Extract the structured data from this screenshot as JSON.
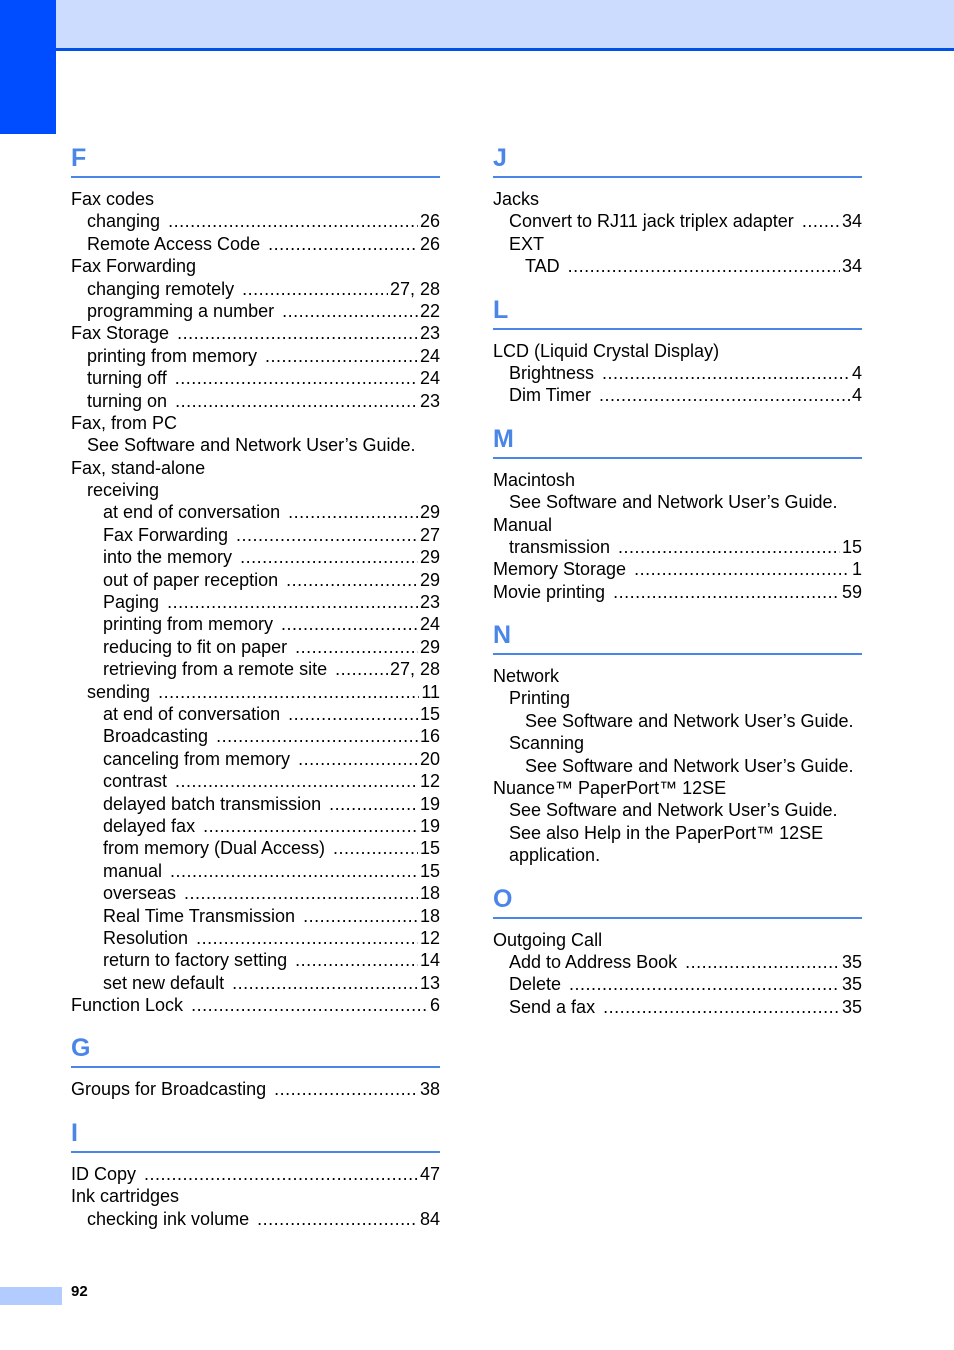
{
  "page_number": "92",
  "colors": {
    "accent": "#4a86e8",
    "tab": "#004dff",
    "header_band": "#ccdcff"
  },
  "left_column": [
    {
      "letter": "F",
      "entries": [
        {
          "level": 0,
          "term": "Fax codes",
          "page": ""
        },
        {
          "level": 1,
          "term": "changing",
          "page": "26"
        },
        {
          "level": 1,
          "term": "Remote Access Code",
          "page": "26"
        },
        {
          "level": 0,
          "term": "Fax Forwarding",
          "page": ""
        },
        {
          "level": 1,
          "term": "changing remotely",
          "page": "27, 28"
        },
        {
          "level": 1,
          "term": "programming a number",
          "page": "22"
        },
        {
          "level": 0,
          "term": "Fax Storage",
          "page": "23"
        },
        {
          "level": 1,
          "term": "printing from memory",
          "page": "24"
        },
        {
          "level": 1,
          "term": "turning off",
          "page": "24"
        },
        {
          "level": 1,
          "term": "turning on",
          "page": "23"
        },
        {
          "level": 0,
          "term": "Fax, from PC",
          "page": ""
        },
        {
          "level": 1,
          "term": "See Software and Network User’s Guide.",
          "page": ""
        },
        {
          "level": 0,
          "term": "Fax, stand-alone",
          "page": ""
        },
        {
          "level": 1,
          "term": "receiving",
          "page": ""
        },
        {
          "level": 2,
          "term": "at end of conversation",
          "page": "29"
        },
        {
          "level": 2,
          "term": "Fax Forwarding",
          "page": "27"
        },
        {
          "level": 2,
          "term": "into the memory",
          "page": "29"
        },
        {
          "level": 2,
          "term": "out of paper reception",
          "page": "29"
        },
        {
          "level": 2,
          "term": "Paging",
          "page": "23"
        },
        {
          "level": 2,
          "term": "printing from memory",
          "page": "24"
        },
        {
          "level": 2,
          "term": "reducing to fit on paper",
          "page": "29"
        },
        {
          "level": 2,
          "term": "retrieving from a remote site",
          "page": "27, 28"
        },
        {
          "level": 1,
          "term": "sending",
          "page": "11"
        },
        {
          "level": 2,
          "term": "at end of conversation",
          "page": "15"
        },
        {
          "level": 2,
          "term": "Broadcasting",
          "page": "16"
        },
        {
          "level": 2,
          "term": "canceling from memory",
          "page": "20"
        },
        {
          "level": 2,
          "term": "contrast",
          "page": "12"
        },
        {
          "level": 2,
          "term": "delayed batch transmission",
          "page": "19"
        },
        {
          "level": 2,
          "term": "delayed fax",
          "page": "19"
        },
        {
          "level": 2,
          "term": "from memory (Dual Access)",
          "page": "15"
        },
        {
          "level": 2,
          "term": "manual",
          "page": "15"
        },
        {
          "level": 2,
          "term": "overseas",
          "page": "18"
        },
        {
          "level": 2,
          "term": "Real Time Transmission",
          "page": "18"
        },
        {
          "level": 2,
          "term": "Resolution",
          "page": "12"
        },
        {
          "level": 2,
          "term": "return to factory setting",
          "page": "14"
        },
        {
          "level": 2,
          "term": "set new default",
          "page": "13"
        },
        {
          "level": 0,
          "term": "Function Lock",
          "page": "6"
        }
      ]
    },
    {
      "letter": "G",
      "entries": [
        {
          "level": 0,
          "term": "Groups for Broadcasting",
          "page": "38"
        }
      ]
    },
    {
      "letter": "I",
      "entries": [
        {
          "level": 0,
          "term": "ID Copy",
          "page": "47"
        },
        {
          "level": 0,
          "term": "Ink cartridges",
          "page": ""
        },
        {
          "level": 1,
          "term": "checking ink volume",
          "page": "84"
        }
      ]
    }
  ],
  "right_column": [
    {
      "letter": "J",
      "entries": [
        {
          "level": 0,
          "term": "Jacks",
          "page": ""
        },
        {
          "level": 1,
          "term": "Convert to RJ11 jack triplex adapter",
          "page": "34"
        },
        {
          "level": 1,
          "term": "EXT",
          "page": ""
        },
        {
          "level": 2,
          "term": "TAD",
          "page": "34"
        }
      ]
    },
    {
      "letter": "L",
      "entries": [
        {
          "level": 0,
          "term": "LCD (Liquid Crystal Display)",
          "page": ""
        },
        {
          "level": 1,
          "term": "Brightness",
          "page": "4"
        },
        {
          "level": 1,
          "term": "Dim Timer",
          "page": "4"
        }
      ]
    },
    {
      "letter": "M",
      "entries": [
        {
          "level": 0,
          "term": "Macintosh",
          "page": ""
        },
        {
          "level": 1,
          "term": "See Software and Network User’s Guide.",
          "page": ""
        },
        {
          "level": 0,
          "term": "Manual",
          "page": ""
        },
        {
          "level": 1,
          "term": "transmission",
          "page": "15"
        },
        {
          "level": 0,
          "term": "Memory Storage",
          "page": "1"
        },
        {
          "level": 0,
          "term": "Movie printing",
          "page": "59"
        }
      ]
    },
    {
      "letter": "N",
      "entries": [
        {
          "level": 0,
          "term": "Network",
          "page": ""
        },
        {
          "level": 1,
          "term": "Printing",
          "page": ""
        },
        {
          "level": 2,
          "term": "See Software and Network User’s Guide.",
          "page": ""
        },
        {
          "level": 1,
          "term": "Scanning",
          "page": ""
        },
        {
          "level": 2,
          "term": "See Software and Network User’s Guide.",
          "page": ""
        },
        {
          "level": 0,
          "term": "Nuance™ PaperPort™ 12SE",
          "page": ""
        },
        {
          "level": 1,
          "term": "See Software and Network User’s Guide.",
          "page": ""
        },
        {
          "level": 1,
          "term": "See also Help in the PaperPort™ 12SE",
          "page": ""
        },
        {
          "level": 1,
          "term": "application.",
          "page": ""
        }
      ]
    },
    {
      "letter": "O",
      "entries": [
        {
          "level": 0,
          "term": "Outgoing Call",
          "page": ""
        },
        {
          "level": 1,
          "term": "Add to Address Book",
          "page": "35"
        },
        {
          "level": 1,
          "term": "Delete",
          "page": "35"
        },
        {
          "level": 1,
          "term": "Send a fax",
          "page": "35"
        }
      ]
    }
  ]
}
